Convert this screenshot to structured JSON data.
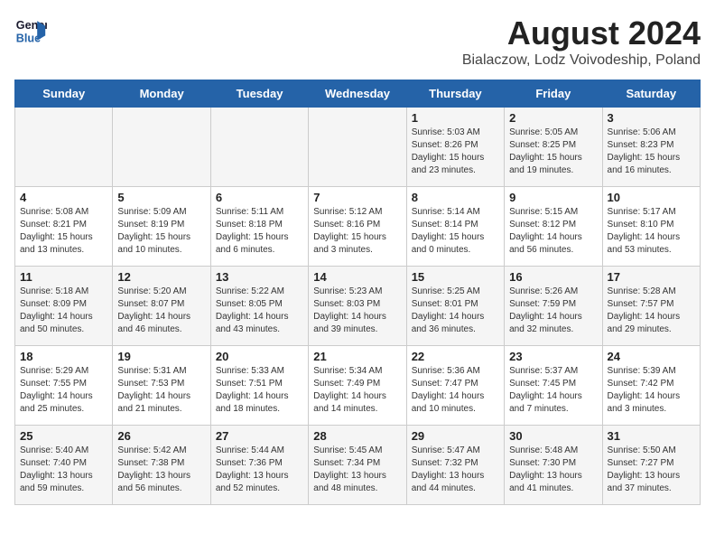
{
  "header": {
    "logo_line1": "General",
    "logo_line2": "Blue",
    "title": "August 2024",
    "subtitle": "Bialaczow, Lodz Voivodeship, Poland"
  },
  "days_of_week": [
    "Sunday",
    "Monday",
    "Tuesday",
    "Wednesday",
    "Thursday",
    "Friday",
    "Saturday"
  ],
  "weeks": [
    [
      {
        "day": "",
        "content": ""
      },
      {
        "day": "",
        "content": ""
      },
      {
        "day": "",
        "content": ""
      },
      {
        "day": "",
        "content": ""
      },
      {
        "day": "1",
        "content": "Sunrise: 5:03 AM\nSunset: 8:26 PM\nDaylight: 15 hours\nand 23 minutes."
      },
      {
        "day": "2",
        "content": "Sunrise: 5:05 AM\nSunset: 8:25 PM\nDaylight: 15 hours\nand 19 minutes."
      },
      {
        "day": "3",
        "content": "Sunrise: 5:06 AM\nSunset: 8:23 PM\nDaylight: 15 hours\nand 16 minutes."
      }
    ],
    [
      {
        "day": "4",
        "content": "Sunrise: 5:08 AM\nSunset: 8:21 PM\nDaylight: 15 hours\nand 13 minutes."
      },
      {
        "day": "5",
        "content": "Sunrise: 5:09 AM\nSunset: 8:19 PM\nDaylight: 15 hours\nand 10 minutes."
      },
      {
        "day": "6",
        "content": "Sunrise: 5:11 AM\nSunset: 8:18 PM\nDaylight: 15 hours\nand 6 minutes."
      },
      {
        "day": "7",
        "content": "Sunrise: 5:12 AM\nSunset: 8:16 PM\nDaylight: 15 hours\nand 3 minutes."
      },
      {
        "day": "8",
        "content": "Sunrise: 5:14 AM\nSunset: 8:14 PM\nDaylight: 15 hours\nand 0 minutes."
      },
      {
        "day": "9",
        "content": "Sunrise: 5:15 AM\nSunset: 8:12 PM\nDaylight: 14 hours\nand 56 minutes."
      },
      {
        "day": "10",
        "content": "Sunrise: 5:17 AM\nSunset: 8:10 PM\nDaylight: 14 hours\nand 53 minutes."
      }
    ],
    [
      {
        "day": "11",
        "content": "Sunrise: 5:18 AM\nSunset: 8:09 PM\nDaylight: 14 hours\nand 50 minutes."
      },
      {
        "day": "12",
        "content": "Sunrise: 5:20 AM\nSunset: 8:07 PM\nDaylight: 14 hours\nand 46 minutes."
      },
      {
        "day": "13",
        "content": "Sunrise: 5:22 AM\nSunset: 8:05 PM\nDaylight: 14 hours\nand 43 minutes."
      },
      {
        "day": "14",
        "content": "Sunrise: 5:23 AM\nSunset: 8:03 PM\nDaylight: 14 hours\nand 39 minutes."
      },
      {
        "day": "15",
        "content": "Sunrise: 5:25 AM\nSunset: 8:01 PM\nDaylight: 14 hours\nand 36 minutes."
      },
      {
        "day": "16",
        "content": "Sunrise: 5:26 AM\nSunset: 7:59 PM\nDaylight: 14 hours\nand 32 minutes."
      },
      {
        "day": "17",
        "content": "Sunrise: 5:28 AM\nSunset: 7:57 PM\nDaylight: 14 hours\nand 29 minutes."
      }
    ],
    [
      {
        "day": "18",
        "content": "Sunrise: 5:29 AM\nSunset: 7:55 PM\nDaylight: 14 hours\nand 25 minutes."
      },
      {
        "day": "19",
        "content": "Sunrise: 5:31 AM\nSunset: 7:53 PM\nDaylight: 14 hours\nand 21 minutes."
      },
      {
        "day": "20",
        "content": "Sunrise: 5:33 AM\nSunset: 7:51 PM\nDaylight: 14 hours\nand 18 minutes."
      },
      {
        "day": "21",
        "content": "Sunrise: 5:34 AM\nSunset: 7:49 PM\nDaylight: 14 hours\nand 14 minutes."
      },
      {
        "day": "22",
        "content": "Sunrise: 5:36 AM\nSunset: 7:47 PM\nDaylight: 14 hours\nand 10 minutes."
      },
      {
        "day": "23",
        "content": "Sunrise: 5:37 AM\nSunset: 7:45 PM\nDaylight: 14 hours\nand 7 minutes."
      },
      {
        "day": "24",
        "content": "Sunrise: 5:39 AM\nSunset: 7:42 PM\nDaylight: 14 hours\nand 3 minutes."
      }
    ],
    [
      {
        "day": "25",
        "content": "Sunrise: 5:40 AM\nSunset: 7:40 PM\nDaylight: 13 hours\nand 59 minutes."
      },
      {
        "day": "26",
        "content": "Sunrise: 5:42 AM\nSunset: 7:38 PM\nDaylight: 13 hours\nand 56 minutes."
      },
      {
        "day": "27",
        "content": "Sunrise: 5:44 AM\nSunset: 7:36 PM\nDaylight: 13 hours\nand 52 minutes."
      },
      {
        "day": "28",
        "content": "Sunrise: 5:45 AM\nSunset: 7:34 PM\nDaylight: 13 hours\nand 48 minutes."
      },
      {
        "day": "29",
        "content": "Sunrise: 5:47 AM\nSunset: 7:32 PM\nDaylight: 13 hours\nand 44 minutes."
      },
      {
        "day": "30",
        "content": "Sunrise: 5:48 AM\nSunset: 7:30 PM\nDaylight: 13 hours\nand 41 minutes."
      },
      {
        "day": "31",
        "content": "Sunrise: 5:50 AM\nSunset: 7:27 PM\nDaylight: 13 hours\nand 37 minutes."
      }
    ]
  ]
}
